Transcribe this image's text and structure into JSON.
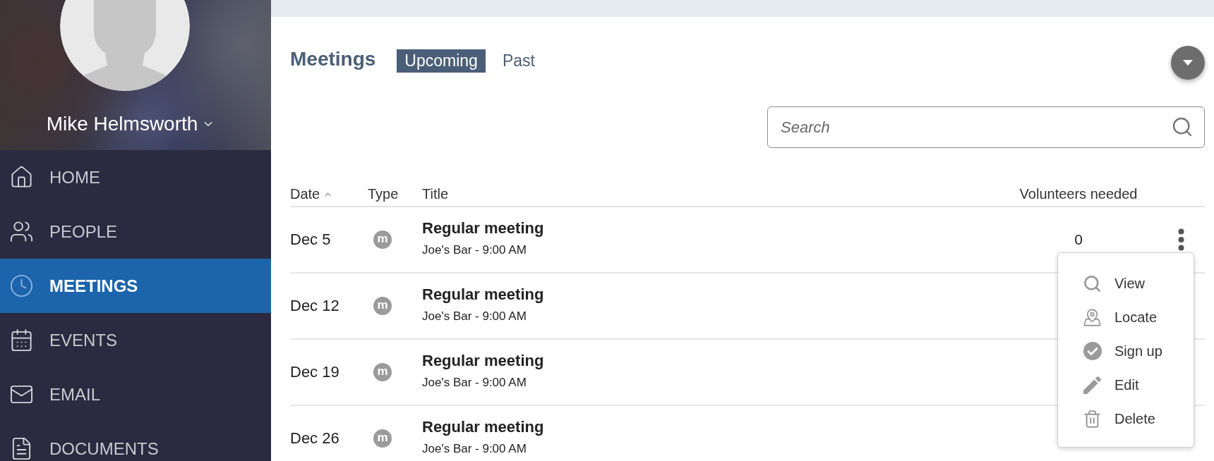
{
  "sidebar": {
    "user_name": "Mike Helmsworth",
    "items": [
      {
        "label": "HOME",
        "selected": false
      },
      {
        "label": "PEOPLE",
        "selected": false
      },
      {
        "label": "MEETINGS",
        "selected": true
      },
      {
        "label": "EVENTS",
        "selected": false
      },
      {
        "label": "EMAIL",
        "selected": false
      },
      {
        "label": "DOCUMENTS",
        "selected": false
      }
    ]
  },
  "page": {
    "title": "Meetings",
    "tabs": [
      {
        "label": "Upcoming",
        "selected": true
      },
      {
        "label": "Past",
        "selected": false
      }
    ]
  },
  "search": {
    "placeholder": "Search"
  },
  "table": {
    "columns": [
      {
        "label": "Date",
        "sorted": true
      },
      {
        "label": "Type",
        "sorted": false
      },
      {
        "label": "Title",
        "sorted": false
      },
      {
        "label": "Volunteers needed",
        "sorted": false
      }
    ],
    "rows": [
      {
        "date": "Dec 5",
        "type": "m",
        "title": "Regular meeting",
        "subtitle": "Joe's Bar - 9:00 AM",
        "volunteers": "0",
        "menu_open": true
      },
      {
        "date": "Dec 12",
        "type": "m",
        "title": "Regular meeting",
        "subtitle": "Joe's Bar - 9:00 AM",
        "menu_open": false
      },
      {
        "date": "Dec 19",
        "type": "m",
        "title": "Regular meeting",
        "subtitle": "Joe's Bar - 9:00 AM",
        "menu_open": false
      },
      {
        "date": "Dec 26",
        "type": "m",
        "title": "Regular meeting",
        "subtitle": "Joe's Bar - 9:00 AM",
        "menu_open": false
      }
    ],
    "row_menu": {
      "items": [
        {
          "label": "View"
        },
        {
          "label": "Locate"
        },
        {
          "label": "Sign up"
        },
        {
          "label": "Edit"
        },
        {
          "label": "Delete"
        }
      ]
    }
  }
}
